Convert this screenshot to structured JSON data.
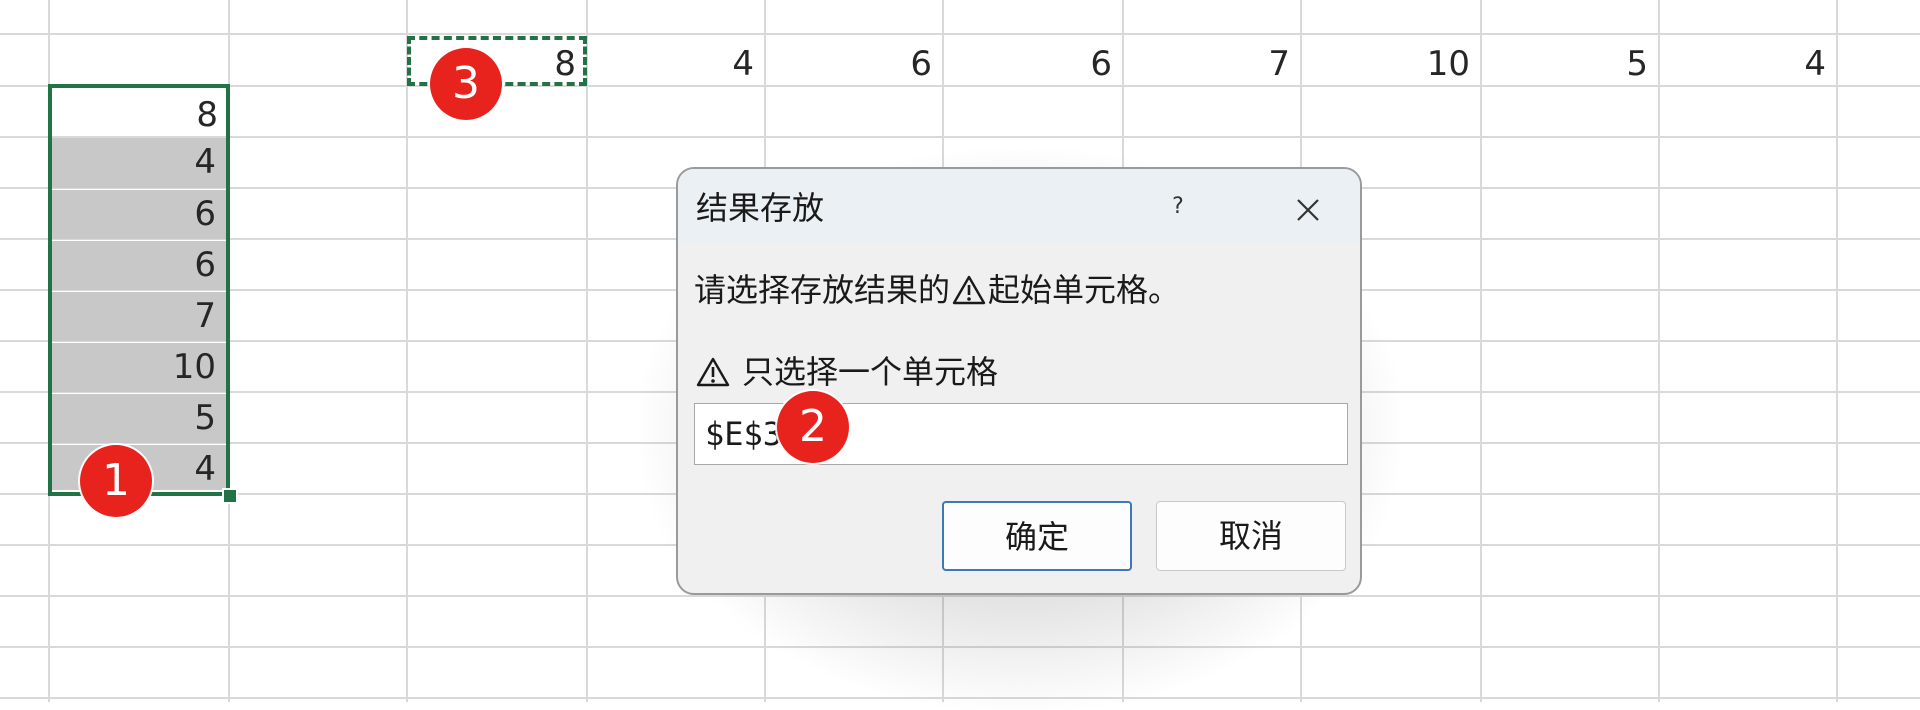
{
  "sheet": {
    "column_values": [
      "8",
      "4",
      "6",
      "6",
      "7",
      "10",
      "5",
      "4"
    ],
    "row_values": [
      "8",
      "4",
      "6",
      "6",
      "7",
      "10",
      "5",
      "4"
    ]
  },
  "badges": [
    "1",
    "2",
    "3"
  ],
  "dialog": {
    "title": "结果存放",
    "help_label": "?",
    "close_label": "✕",
    "prompt_before": "请选择存放结果的",
    "prompt_after": "起始单元格。",
    "warning_text": "只选择一个单元格",
    "input_value": "$E$3",
    "ok_label": "确定",
    "cancel_label": "取消"
  },
  "icons": {
    "prompt_icon": "warning-triangle-icon",
    "warning_icon": "warning-triangle-icon"
  },
  "colors": {
    "selection_border": "#217346",
    "badge": "#e8231e",
    "selected_fill": "#c8c8c8",
    "ok_button_border": "#3c79b6"
  }
}
